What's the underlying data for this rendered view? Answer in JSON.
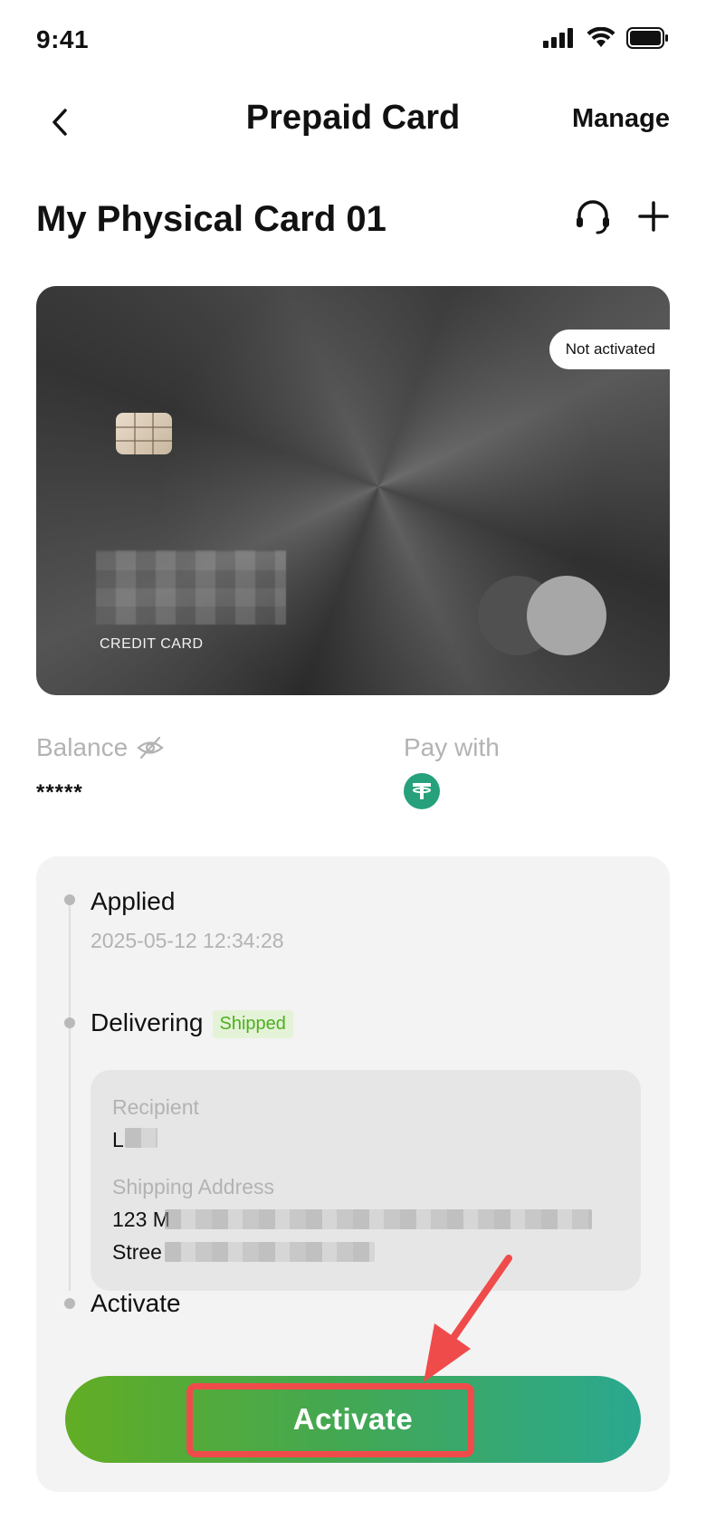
{
  "status_bar": {
    "time": "9:41"
  },
  "nav": {
    "title": "Prepaid Card",
    "manage_label": "Manage"
  },
  "card_header": {
    "name": "My Physical Card 01"
  },
  "card": {
    "status_badge": "Not activated",
    "type_label": "CREDIT CARD"
  },
  "balance": {
    "label": "Balance",
    "value": "*****",
    "pay_label": "Pay with",
    "pay_icon": "tether-usdt-icon"
  },
  "progress": {
    "steps": [
      {
        "title": "Applied",
        "date": "2025-05-12 12:34:28"
      },
      {
        "title": "Delivering",
        "badge": "Shipped"
      },
      {
        "title": "Activate"
      }
    ],
    "recipient_label": "Recipient",
    "recipient_value": "L",
    "address_label": "Shipping Address",
    "address_line1": "123 M",
    "address_line2": "Stree"
  },
  "activate_button": {
    "label": "Activate"
  },
  "colors": {
    "accent_start": "#62ad24",
    "accent_end": "#2aa88f",
    "annotation": "#f04b4b",
    "shipped": "#4caf1f"
  }
}
